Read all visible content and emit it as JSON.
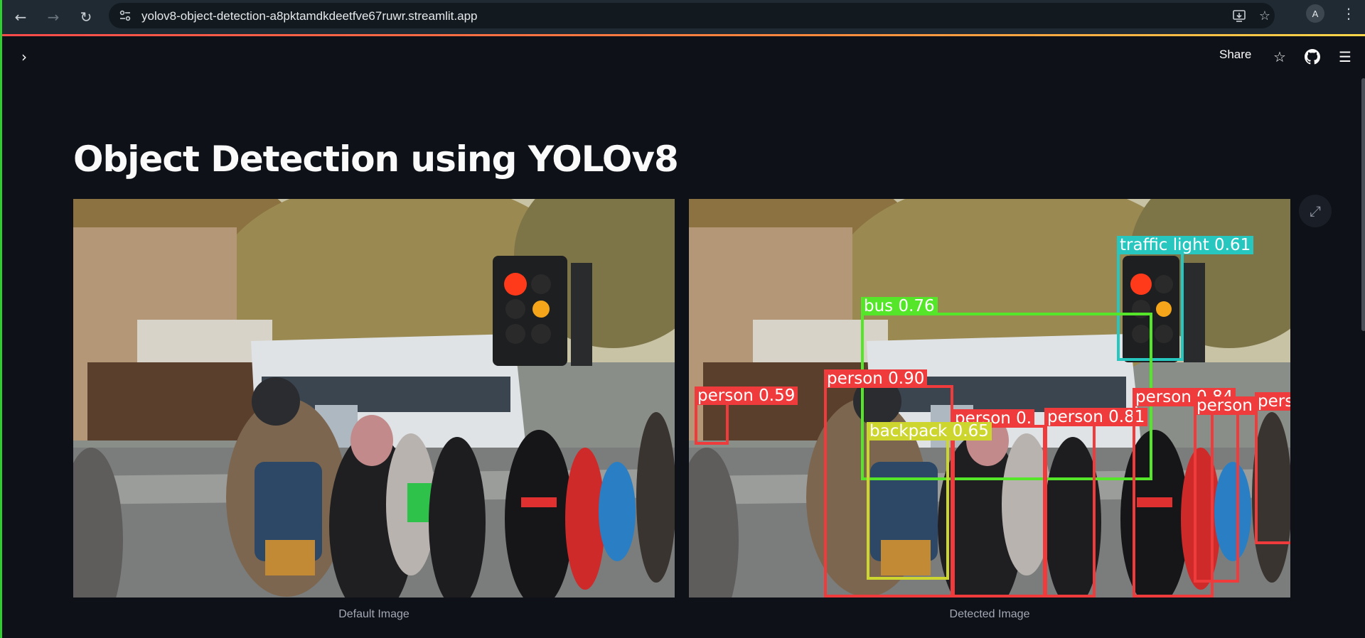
{
  "browser": {
    "url": "yolov8-object-detection-a8pktamdkdeetfve67ruwr.streamlit.app",
    "profile_initial": "A"
  },
  "header": {
    "share_label": "Share"
  },
  "main": {
    "title": "Object Detection using YOLOv8",
    "images": [
      {
        "caption": "Default Image"
      },
      {
        "caption": "Detected Image"
      }
    ]
  },
  "detections": [
    {
      "label": "traffic light 0.61",
      "class": "traffic light",
      "confidence": 0.61,
      "color": "#27c7c0"
    },
    {
      "label": "bus 0.76",
      "class": "bus",
      "confidence": 0.76,
      "color": "#55e62a"
    },
    {
      "label": "person 0.90",
      "class": "person",
      "confidence": 0.9,
      "color": "#ef3b3b"
    },
    {
      "label": "person 0.59",
      "class": "person",
      "confidence": 0.59,
      "color": "#ef3b3b"
    },
    {
      "label": "person 0.",
      "class": "person",
      "color": "#ef3b3b"
    },
    {
      "label": "person 0.81",
      "class": "person",
      "confidence": 0.81,
      "color": "#ef3b3b"
    },
    {
      "label": "person 0.84",
      "class": "person",
      "confidence": 0.84,
      "color": "#ef3b3b"
    },
    {
      "label": "person",
      "class": "person",
      "color": "#ef3b3b"
    },
    {
      "label": "pers",
      "class": "person",
      "color": "#ef3b3b"
    },
    {
      "label": "backpack 0.65",
      "class": "backpack",
      "confidence": 0.65,
      "color": "#cdd62e"
    }
  ]
}
